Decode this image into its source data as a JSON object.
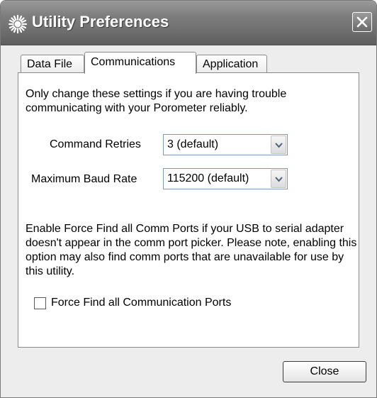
{
  "window": {
    "title": "Utility Preferences",
    "icon": "gear-icon"
  },
  "tabs": [
    {
      "label": "Data File",
      "selected": false
    },
    {
      "label": "Communications",
      "selected": true
    },
    {
      "label": "Application",
      "selected": false
    }
  ],
  "panel": {
    "intro": "Only change these settings if you are having trouble communicating with your Porometer reliably.",
    "command_retries": {
      "label": "Command Retries",
      "value": "3 (default)"
    },
    "max_baud": {
      "label": "Maximum Baud Rate",
      "value": "115200 (default)"
    },
    "force_find_note": "Enable Force Find all Comm Ports if your USB to serial adapter doesn't appear in the comm port picker. Please note, enabling this option may also find comm ports that are unavailable for use by this utility.",
    "force_find_checkbox": {
      "label": "Force Find all Communication Ports",
      "checked": false
    }
  },
  "footer": {
    "close_label": "Close"
  },
  "colors": {
    "titlebar": "#7d7d7d",
    "window_bg": "#ededed",
    "panel_bg": "#ffffff"
  }
}
